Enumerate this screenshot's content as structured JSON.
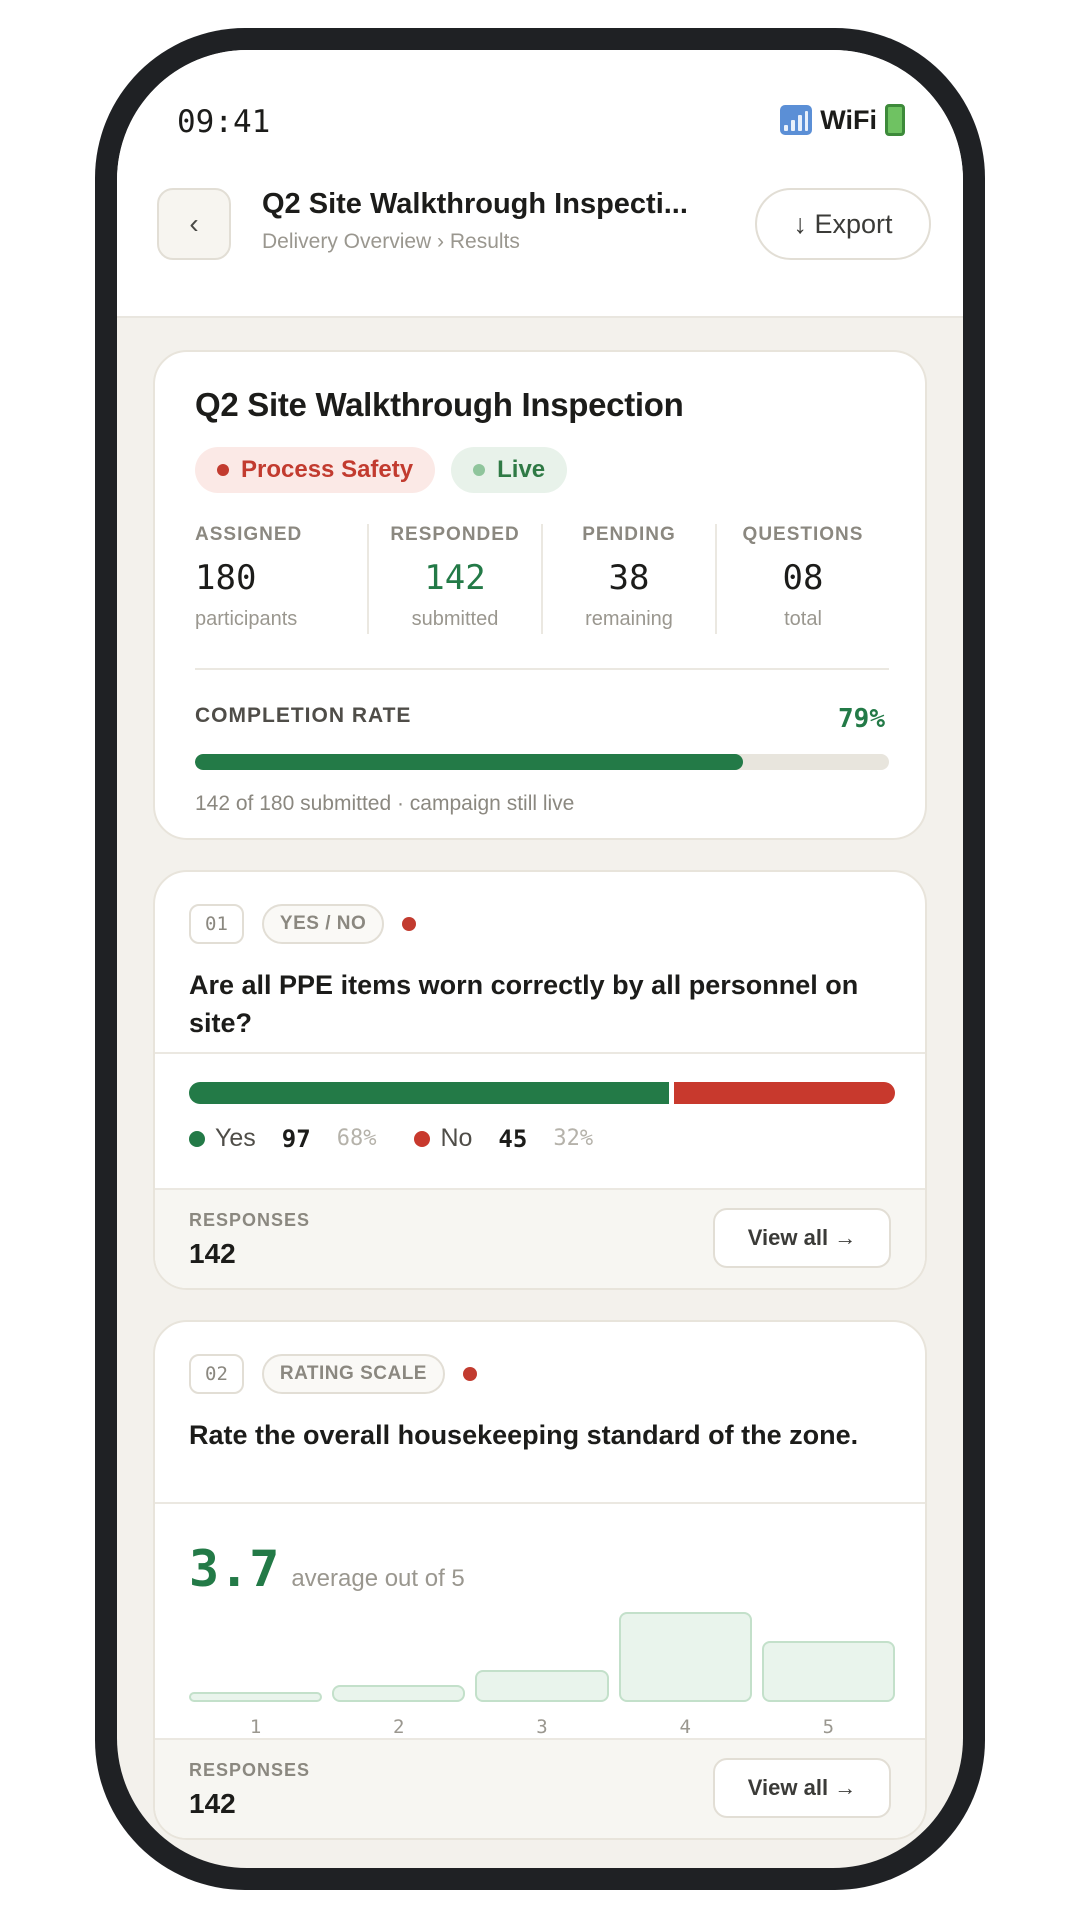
{
  "status_bar": {
    "time": "09:41",
    "wifi_label": "WiFi",
    "signal_icon": "signal-icon",
    "battery_icon": "battery-icon"
  },
  "header": {
    "back_label": "‹",
    "title": "Q2 Site Walkthrough Inspecti...",
    "breadcrumb": "Delivery Overview › Results",
    "export_label": "↓ Export"
  },
  "summary": {
    "title": "Q2 Site Walkthrough Inspection",
    "tags": [
      {
        "label": "Process Safety",
        "color": "#c23b2f"
      },
      {
        "label": "Live",
        "color": "#2f7a45"
      }
    ],
    "stats": [
      {
        "label": "ASSIGNED",
        "value": "180",
        "sub": "participants"
      },
      {
        "label": "RESPONDED",
        "value": "142",
        "sub": "submitted"
      },
      {
        "label": "PENDING",
        "value": "38",
        "sub": "remaining"
      },
      {
        "label": "QUESTIONS",
        "value": "08",
        "sub": "total"
      }
    ],
    "completion_label": "COMPLETION RATE",
    "completion_pct": "79%",
    "completion_fraction": 0.79,
    "completion_note": "142 of 180 submitted · campaign still live"
  },
  "questions": [
    {
      "number": "01",
      "type": "YES / NO",
      "text": "Are all PPE items worn correctly by all personnel on site?",
      "yes": {
        "label": "Yes",
        "count": "97",
        "pct": "68%",
        "fraction": 0.68,
        "color": "#237a47"
      },
      "no": {
        "label": "No",
        "count": "45",
        "pct": "32%",
        "fraction": 0.32,
        "color": "#c8392d"
      },
      "responses_label": "RESPONSES",
      "responses": "142",
      "view_label": "View all →"
    },
    {
      "number": "02",
      "type": "RATING SCALE",
      "text": "Rate the overall housekeeping standard of the zone.",
      "average": "3.7",
      "average_note": "average out of 5",
      "distribution": [
        {
          "label": "1",
          "share": 0.1
        },
        {
          "label": "2",
          "share": 0.19
        },
        {
          "label": "3",
          "share": 0.36
        },
        {
          "label": "4",
          "share": 1.0
        },
        {
          "label": "5",
          "share": 0.68
        }
      ],
      "responses_label": "RESPONSES",
      "responses": "142",
      "view_label": "View all →"
    }
  ],
  "colors": {
    "accent_green": "#237a47",
    "alert_red": "#c23b2f",
    "background": "#f3f1ec"
  }
}
